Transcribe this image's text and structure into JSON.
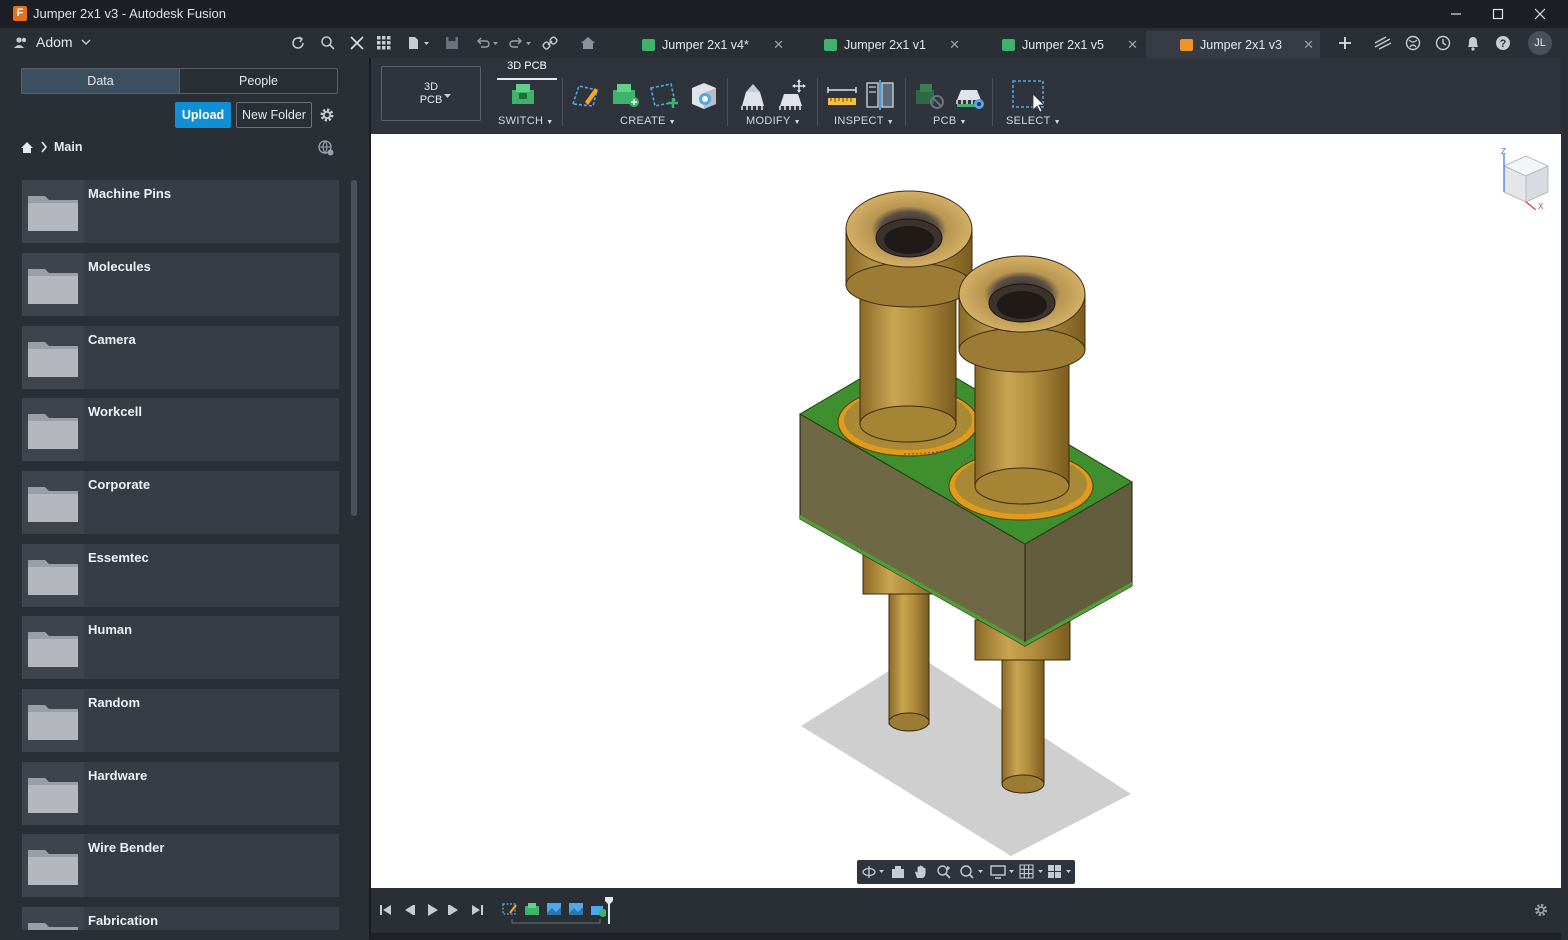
{
  "window": {
    "title": "Jumper 2x1 v3 - Autodesk Fusion",
    "logo_letter": "F"
  },
  "appbar": {
    "team_name": "Adom",
    "user_initials": "JL"
  },
  "tabs": [
    {
      "label": "Jumper 2x1 v4*",
      "active": false,
      "icon_color": "#3db36b"
    },
    {
      "label": "Jumper 2x1 v1",
      "active": false,
      "icon_color": "#3db36b"
    },
    {
      "label": "Jumper 2x1 v5",
      "active": false,
      "icon_color": "#3db36b"
    },
    {
      "label": "Jumper 2x1 v3",
      "active": true,
      "icon_color": "#f0932b"
    }
  ],
  "data_panel": {
    "segments": [
      "Data",
      "People"
    ],
    "upload_label": "Upload",
    "new_folder_label": "New Folder",
    "breadcrumb": "Main",
    "folders": [
      "Machine Pins",
      "Molecules",
      "Camera",
      "Workcell",
      "Corporate",
      "Essemtec",
      "Human",
      "Random",
      "Hardware",
      "Wire Bender",
      "Fabrication"
    ]
  },
  "toolbar": {
    "workspace_line1": "3D",
    "workspace_line2": "PCB",
    "workspace_tab": "3D PCB",
    "groups": [
      "SWITCH",
      "CREATE",
      "MODIFY",
      "INSPECT",
      "PCB",
      "SELECT"
    ]
  },
  "colors": {
    "accent": "#0e8fd6",
    "pcb_green": "#3f8f2e",
    "pin_brass": "#b8953f"
  }
}
